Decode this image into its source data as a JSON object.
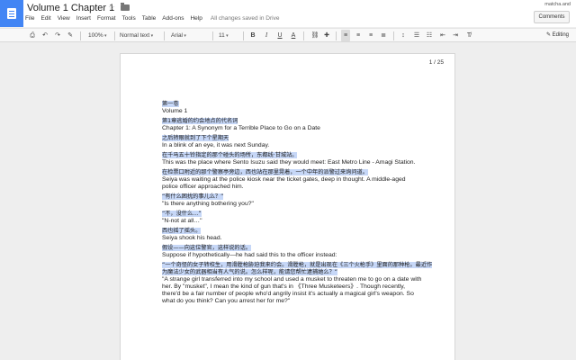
{
  "header": {
    "title": "Volume 1 Chapter 1",
    "menu": [
      "File",
      "Edit",
      "View",
      "Insert",
      "Format",
      "Tools",
      "Table",
      "Add-ons",
      "Help"
    ],
    "save_status": "All changes saved in Drive",
    "user_email": "matcha.and",
    "comments_label": "Comments"
  },
  "toolbar": {
    "zoom": "100%",
    "style": "Normal text",
    "font": "Arial",
    "size": "11",
    "mode": "Editing",
    "icons": [
      "print-icon",
      "undo-icon",
      "redo-icon",
      "paint-format-icon",
      "link-icon",
      "comment-icon",
      "align-left-icon",
      "align-center-icon",
      "align-right-icon",
      "justify-icon",
      "line-spacing-icon",
      "numbered-list-icon",
      "bulleted-list-icon",
      "decrease-indent-icon",
      "increase-indent-icon",
      "clear-formatting-icon",
      "pencil-icon"
    ]
  },
  "page": {
    "page_number": "1 / 25",
    "paragraphs": [
      {
        "zh": "第一卷",
        "en": [
          "Volume 1"
        ]
      },
      {
        "zh": "第1章逃婚的约会地点的代名词",
        "en": [
          "Chapter 1: A Synonym for a Terrible Place to Go on a Date"
        ]
      },
      {
        "zh": "之后转眼就到了下个星期天",
        "en": [
          "In a blink of an eye, it was next Sunday."
        ]
      },
      {
        "zh": "在千马五十铃指定的那个碰头的场所，东都线·甘城站。",
        "en": [
          "This was the place where Sento Isuzu said they would meet: East Metro Line - Amagi Station."
        ]
      },
      {
        "zh": "在检票口附近的那个警察亭旁边，西也站在那里晃着，一个中年的派警过来询问道。",
        "en": [
          "Seiya was waiting at the police kiosk near the ticket gates, deep in thought. A middle-aged",
          "police officer approached him."
        ]
      },
      {
        "zh": "“有什么困扰的事儿么？”",
        "en": [
          "\"Is there anything bothering you?\""
        ]
      },
      {
        "zh": "“不，没什么…”",
        "en": [
          "\"N-not at all…\""
        ]
      },
      {
        "zh": "西也摇了摇头。",
        "en": [
          "Seiya shook his head."
        ]
      },
      {
        "zh": "假设——向这位警官，这样说的话。",
        "en": [
          "Suppose if hypothetically—he had said this to the officer instead:"
        ]
      },
      {
        "zh": "“一个奇怪的女子转校生，用滑膛枪胁迫我来约会。滑膛枪，就是出现在《三个火枪手》里面的那种枪。最近作为魔法少女的武器相当有人气的说。怎么样呢，能请您帮忙逮捕她么？”",
        "en": [
          "\"A strange girl transferred into my school and used a musket to threaten me to go on a date with",
          "her. By \"musket\", I mean the kind of gun that's in 《Three Musketeers》. Though recently,",
          "there'd be a fair number of people who'd angrily insist it's actually a magical girl's weapon. So",
          "what do you think? Can you arrest her for me?\""
        ]
      }
    ]
  }
}
